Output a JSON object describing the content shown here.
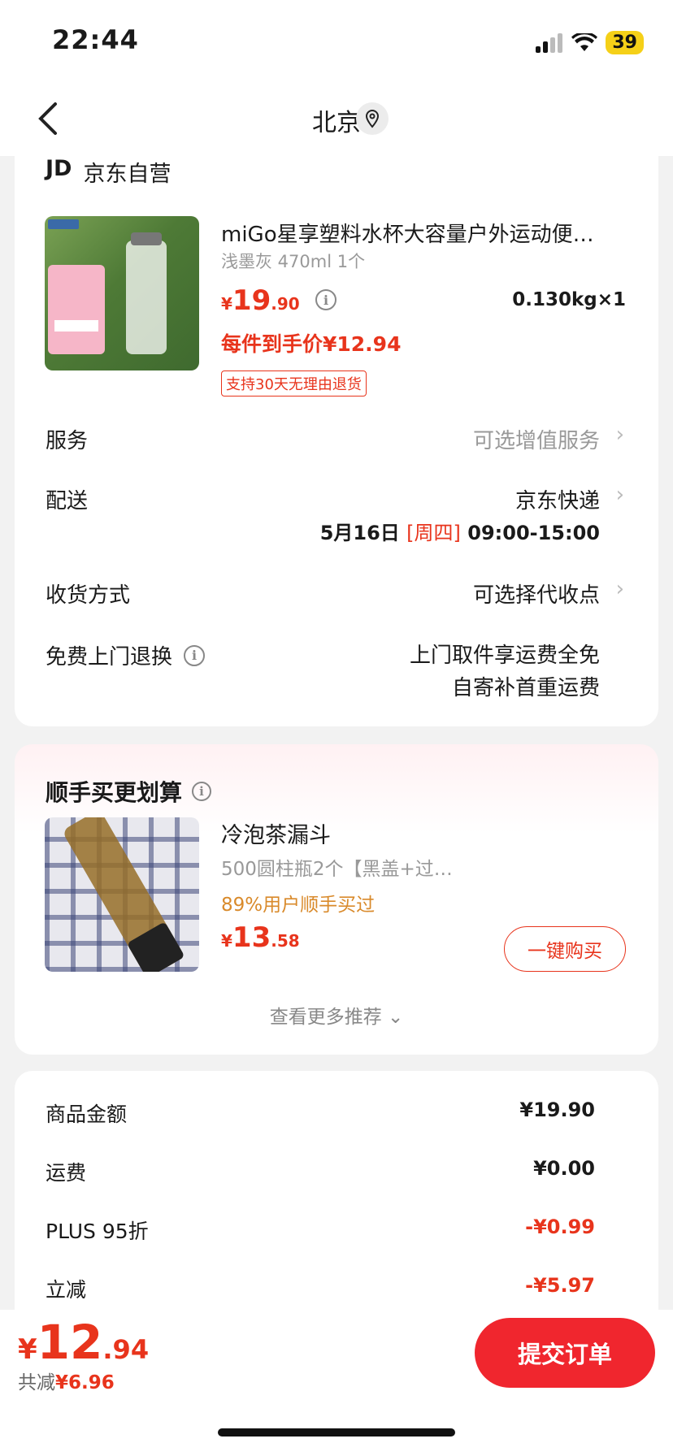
{
  "status_bar": {
    "time": "22:44",
    "battery": "39"
  },
  "nav": {
    "title": "北京"
  },
  "shop": {
    "logo": "JD",
    "name": "京东自营"
  },
  "product": {
    "title": "miGo星享塑料水杯大容量户外运动便…",
    "spec": "浅墨灰 470ml 1个",
    "price_yen": "¥",
    "price_int": "19",
    "price_dec": ".90",
    "weight": "0.130kg×1",
    "each_price": "每件到手价¥12.94",
    "return_badge": "支持30天无理由退货"
  },
  "rows": {
    "service_label": "服务",
    "service_value": "可选增值服务",
    "delivery_label": "配送",
    "delivery_value": "京东快递",
    "delivery_date": "5月16日",
    "delivery_weekday": "[周四]",
    "delivery_time": "09:00-15:00",
    "receive_label": "收货方式",
    "receive_value": "可选择代收点",
    "return_label": "免费上门退换",
    "return_value_1": "上门取件享运费全免",
    "return_value_2": "自寄补首重运费"
  },
  "recommend": {
    "section_title": "顺手买更划算",
    "title": "冷泡茶漏斗",
    "spec": "500圆柱瓶2个【黑盖+过…",
    "percent": "89%用户顺手买过",
    "price_yen": "¥",
    "price_int": "13",
    "price_dec": ".58",
    "buy_button": "一键购买",
    "more": "查看更多推荐 ⌄"
  },
  "summary": {
    "goods_label": "商品金额",
    "goods_value": "¥19.90",
    "shipping_label": "运费",
    "shipping_value": "¥0.00",
    "plus_label": "PLUS 95折",
    "plus_value": "-¥0.99",
    "discount_label": "立减",
    "discount_value": "-¥5.97"
  },
  "bottom": {
    "total_yen": "¥",
    "total_int": "12",
    "total_dec": ".94",
    "saved_label": "共减",
    "saved_value": "¥6.96",
    "submit": "提交订单"
  },
  "colors": {
    "accent": "#e8341c",
    "submit_bg": "#f0262e",
    "orange": "#d98a2b"
  }
}
